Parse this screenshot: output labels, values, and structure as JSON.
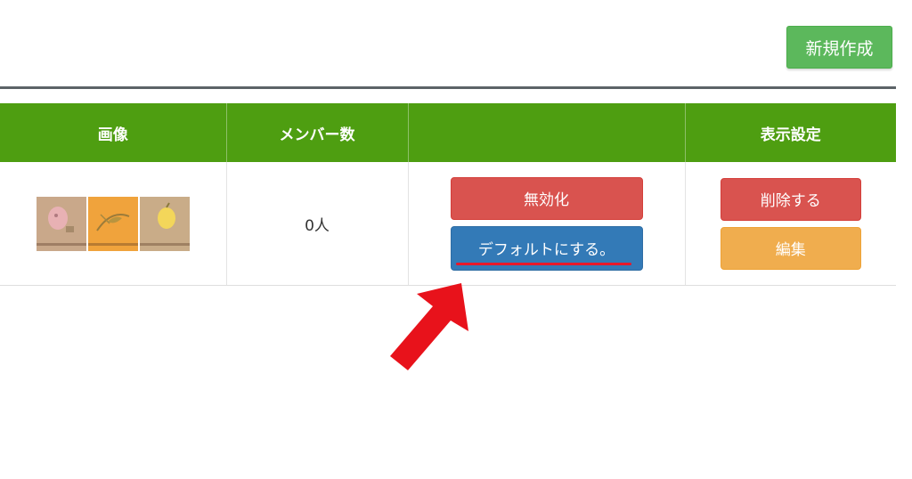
{
  "toolbar": {
    "new_label": "新規作成"
  },
  "table": {
    "headers": [
      "画像",
      "メンバー数",
      "",
      "表示設定"
    ],
    "rows": [
      {
        "image_icons": [
          "pink-figure-icon",
          "leaf-icon",
          "yellow-round-icon"
        ],
        "image_colors": [
          "#c9a88a",
          "#f0a33c",
          "#c9ac88"
        ],
        "member_count": "0人",
        "actions": {
          "disable": "無効化",
          "set_default": "デフォルトにする。"
        },
        "display": {
          "delete": "削除する",
          "edit": "編集"
        }
      }
    ]
  },
  "annotation": {
    "arrow_color": "#e8121b",
    "underline_color": "#e8182a"
  }
}
